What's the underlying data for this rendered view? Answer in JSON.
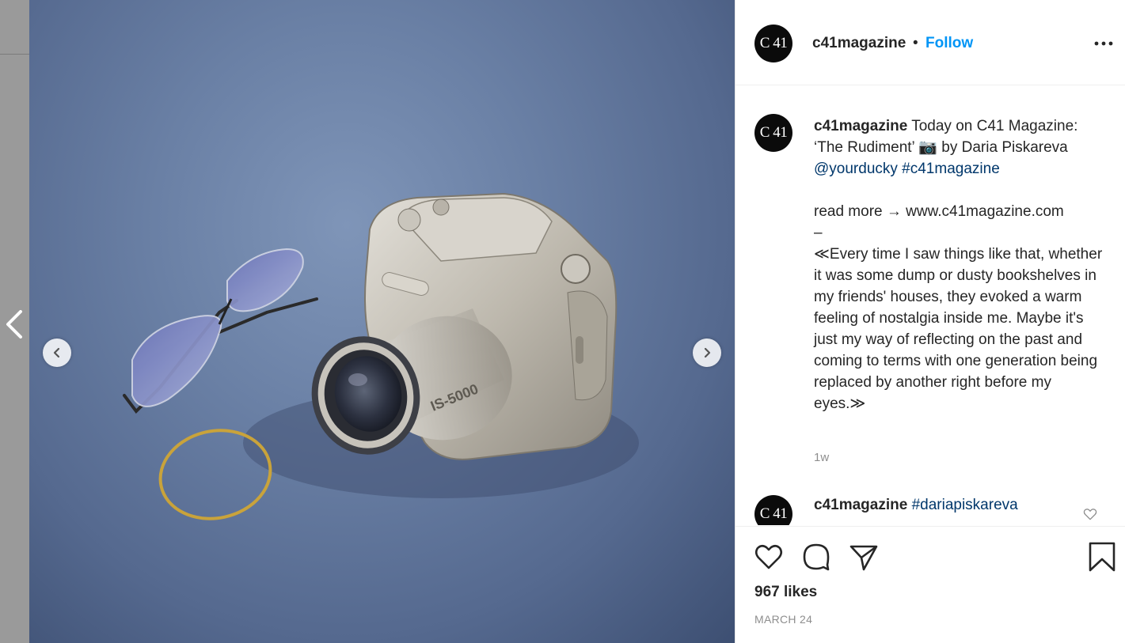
{
  "post": {
    "username": "c41magazine",
    "separator": "•",
    "follow_label": "Follow",
    "avatar_text": "C 41",
    "image_label": "IS-5000"
  },
  "comments": [
    {
      "username": "c41magazine",
      "text_line1": " Today on C41 Magazine: ‘The Rudiment’ 📷 by Daria Piskareva",
      "mention": "@yourducky",
      "hashtag": "#c41magazine",
      "read_more": "read more → www.c41magazine.com",
      "dash": "–",
      "quote": "≪Every time I saw things like that, whether it was some dump or dusty bookshelves in my friends' houses, they evoked a warm feeling of nostalgia inside me. Maybe it's just my way of reflecting on the past and coming to terms with one generation being replaced by another right before my eyes.≫",
      "time": "1w"
    },
    {
      "username": "c41magazine",
      "hashtag": "#dariapiskareva"
    }
  ],
  "stats": {
    "likes": "967 likes",
    "date": "MARCH 24"
  },
  "icons": {
    "more": "more-options-icon",
    "like": "heart-icon",
    "comment": "comment-icon",
    "share": "paper-plane-icon",
    "save": "bookmark-icon",
    "prev": "chevron-left-icon",
    "next": "chevron-right-icon"
  }
}
